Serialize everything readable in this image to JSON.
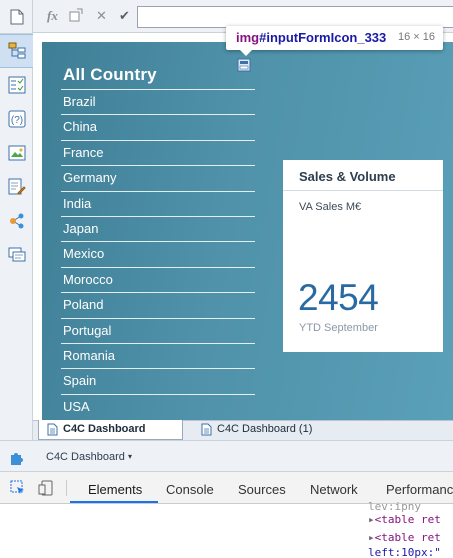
{
  "formula_bar": {
    "fx_label": "fx",
    "cancel_icon": "close-icon",
    "accept_icon": "check-icon",
    "input_value": ""
  },
  "tooltip": {
    "tag": "img",
    "id": "#inputFormIcon_333",
    "size": "16 × 16"
  },
  "country_list": {
    "title": "All Country",
    "items": [
      "Brazil",
      "China",
      "France",
      "Germany",
      "India",
      "Japan",
      "Mexico",
      "Morocco",
      "Poland",
      "Portugal",
      "Romania",
      "Spain",
      "USA"
    ]
  },
  "card": {
    "title": "Sales & Volume",
    "subtitle": "VA Sales M€",
    "value": "2454",
    "footnote": "YTD September"
  },
  "sheet_tabs": [
    {
      "label": "C4C Dashboard",
      "active": true
    },
    {
      "label": "C4C Dashboard (1)",
      "active": false
    }
  ],
  "app_bar": {
    "name": "C4C Dashboard",
    "caret": "▾"
  },
  "devtools": {
    "tabs": [
      "Elements",
      "Console",
      "Sources",
      "Network",
      "Performanc"
    ],
    "active_tab": "Elements",
    "code": {
      "line1": "lev:ipny",
      "line2": "<table ret",
      "line3": "<table ret",
      "line4": "left:10px:\""
    }
  },
  "colors": {
    "canvas_gradient_start": "#3f7f96",
    "canvas_gradient_end": "#5aa0b8",
    "value_color": "#2a6aa3",
    "devtools_accent": "#1a73e8"
  }
}
